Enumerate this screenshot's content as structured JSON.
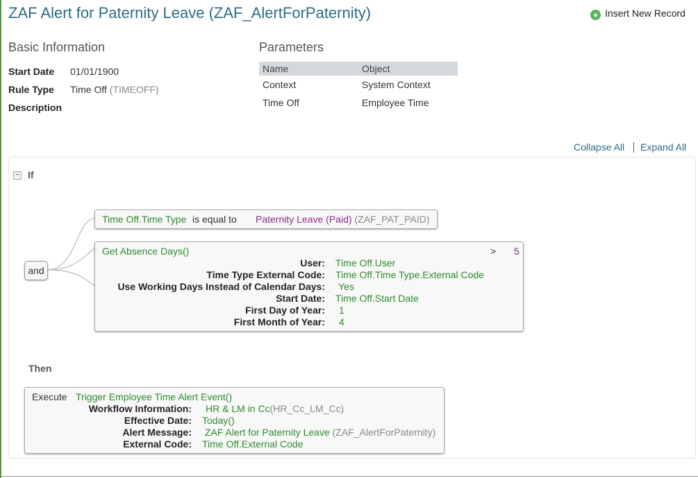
{
  "page_title": "ZAF Alert for Paternity Leave (ZAF_AlertForPaternity)",
  "insert_record_label": "Insert New Record",
  "basic_info": {
    "heading": "Basic Information",
    "start_date_label": "Start Date",
    "start_date_value": "01/01/1900",
    "rule_type_label": "Rule Type",
    "rule_type_value": "Time Off",
    "rule_type_code": "(TIMEOFF)",
    "description_label": "Description"
  },
  "parameters": {
    "heading": "Parameters",
    "columns": [
      "Name",
      "Object"
    ],
    "rows": [
      [
        "Context",
        "System Context"
      ],
      [
        "Time Off",
        "Employee Time"
      ]
    ]
  },
  "toolbar": {
    "collapse_all": "Collapse All",
    "expand_all": "Expand All"
  },
  "if_block": {
    "minus_glyph": "−",
    "label": "If",
    "and_label": "and",
    "condition1": {
      "field": "Time Off.Time Type",
      "operator": "is equal to",
      "value": "Paternity Leave (Paid)",
      "code": "(ZAF_PAT_PAID)"
    },
    "condition2": {
      "function": "Get Absence Days()",
      "operator": ">",
      "value": "5",
      "params": [
        {
          "label": "User:",
          "value": "Time Off.User"
        },
        {
          "label": "Time Type External Code:",
          "value": "Time Off.Time Type.External Code"
        },
        {
          "label": "Use Working Days Instead of Calendar Days:",
          "value": "Yes"
        },
        {
          "label": "Start Date:",
          "value": "Time Off.Start Date"
        },
        {
          "label": "First Day of Year:",
          "value": "1"
        },
        {
          "label": "First Month of Year:",
          "value": "4"
        }
      ]
    }
  },
  "then_block": {
    "label": "Then",
    "execute_label": "Execute",
    "function": "Trigger Employee Time Alert Event()",
    "params": [
      {
        "label": "Workflow Information:",
        "value": "HR & LM in Cc",
        "code": "(HR_Cc_LM_Cc)"
      },
      {
        "label": "Effective Date:",
        "value": "Today()",
        "code": ""
      },
      {
        "label": "Alert Message:",
        "value": "ZAF Alert for Paternity Leave",
        "code": "(ZAF_AlertForPaternity)"
      },
      {
        "label": "External Code:",
        "value": "Time Off.External Code",
        "code": ""
      }
    ]
  }
}
